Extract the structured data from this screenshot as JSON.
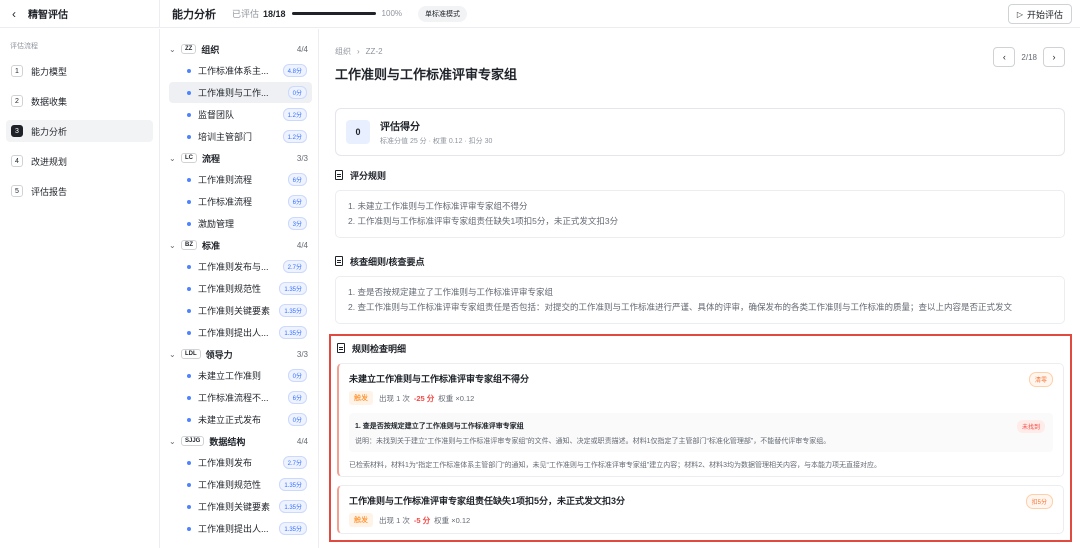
{
  "header": {
    "back_icon": "chevron-left-icon",
    "brand_title": "精智评估",
    "title": "能力分析",
    "progress_label": "已评估",
    "progress_count": "18/18",
    "progress_value": 1.0,
    "progress_pct": "100%",
    "mode_tag": "单标准模式",
    "start_button": "开始评估"
  },
  "leftnav": {
    "heading": "评估流程",
    "items": [
      {
        "num": "1",
        "label": "能力模型"
      },
      {
        "num": "2",
        "label": "数据收集"
      },
      {
        "num": "3",
        "label": "能力分析"
      },
      {
        "num": "4",
        "label": "改进规划"
      },
      {
        "num": "5",
        "label": "评估报告"
      }
    ]
  },
  "tree": {
    "groups": [
      {
        "code": "ZZ",
        "name": "组织",
        "count": "4/4",
        "items": [
          {
            "name": "工作标准体系主...",
            "score": "4.8分"
          },
          {
            "name": "工作准则与工作...",
            "score": "0分"
          },
          {
            "name": "监督团队",
            "score": "1.2分"
          },
          {
            "name": "培训主管部门",
            "score": "1.2分"
          }
        ]
      },
      {
        "code": "LC",
        "name": "流程",
        "count": "3/3",
        "items": [
          {
            "name": "工作准则流程",
            "score": "6分"
          },
          {
            "name": "工作标准流程",
            "score": "6分"
          },
          {
            "name": "激励管理",
            "score": "3分"
          }
        ]
      },
      {
        "code": "BZ",
        "name": "标准",
        "count": "4/4",
        "items": [
          {
            "name": "工作准则发布与...",
            "score": "2.7分"
          },
          {
            "name": "工作准则规范性",
            "score": "1.35分"
          },
          {
            "name": "工作准则关键要素",
            "score": "1.35分"
          },
          {
            "name": "工作准则提出人...",
            "score": "1.35分"
          }
        ]
      },
      {
        "code": "LDL",
        "name": "领导力",
        "count": "3/3",
        "items": [
          {
            "name": "未建立工作准则",
            "score": "0分"
          },
          {
            "name": "工作标准流程不...",
            "score": "6分"
          },
          {
            "name": "未建立正式发布",
            "score": "0分"
          }
        ]
      },
      {
        "code": "SJJG",
        "name": "数据结构",
        "count": "4/4",
        "items": [
          {
            "name": "工作准则发布",
            "score": "2.7分"
          },
          {
            "name": "工作准则规范性",
            "score": "1.35分"
          },
          {
            "name": "工作准则关键要素",
            "score": "1.35分"
          },
          {
            "name": "工作准则提出人...",
            "score": "1.35分"
          }
        ]
      }
    ]
  },
  "main": {
    "breadcrumb": [
      "组织",
      "ZZ-2"
    ],
    "title": "工作准则与工作标准评审专家组",
    "pager": {
      "text": "2/18"
    },
    "score_card": {
      "value": "0",
      "title": "评估得分",
      "subtitle": "标准分值 25 分 · 权重 0.12 · 扣分 30"
    },
    "rules": {
      "heading": "评分规则",
      "lines": [
        "1. 未建立工作准则与工作标准评审专家组不得分",
        "2. 工作准则与工作标准评审专家组责任缺失1项扣5分，未正式发文扣3分"
      ]
    },
    "checkpoints": {
      "heading": "核查细则/核查要点",
      "lines": [
        "1. 查是否按规定建立了工作准则与工作标准评审专家组",
        "2. 查工作准则与工作标准评审专家组责任是否包括：对提交的工作准则与工作标准进行严谨、具体的评审，确保发布的各类工作准则与工作标准的质量；查以上内容是否正式发文"
      ]
    },
    "details": {
      "heading": "规则检查明细",
      "cards": [
        {
          "title": "未建立工作准则与工作标准评审专家组不得分",
          "status": "清零",
          "trigger": "触发",
          "occurrence": "出现 1 次",
          "delta": "-25 分",
          "weight": "权重 ×0.12",
          "sub_title": "1. 查是否按规定建立了工作准则与工作标准评审专家组",
          "sub_desc": "说明：未找到关于建立“工作准则与工作标准评审专家组”的文件、通知、决定或职责描述。材料1仅指定了主管部门“标准化管理部”，不能替代评审专家组。",
          "sub_status": "未找到",
          "evidence": "已检索材料，材料1为“指定工作标准体系主管部门”的通知，未见“工作准则与工作标准评审专家组”建立内容；材料2、材料3均为数据管理相关内容，与本能力项无直接对应。"
        },
        {
          "title": "工作准则与工作标准评审专家组责任缺失1项扣5分，未正式发文扣3分",
          "status": "扣5分",
          "trigger": "触发",
          "occurrence": "出现 1 次",
          "delta": "-5 分",
          "weight": "权重 ×0.12"
        }
      ]
    }
  }
}
